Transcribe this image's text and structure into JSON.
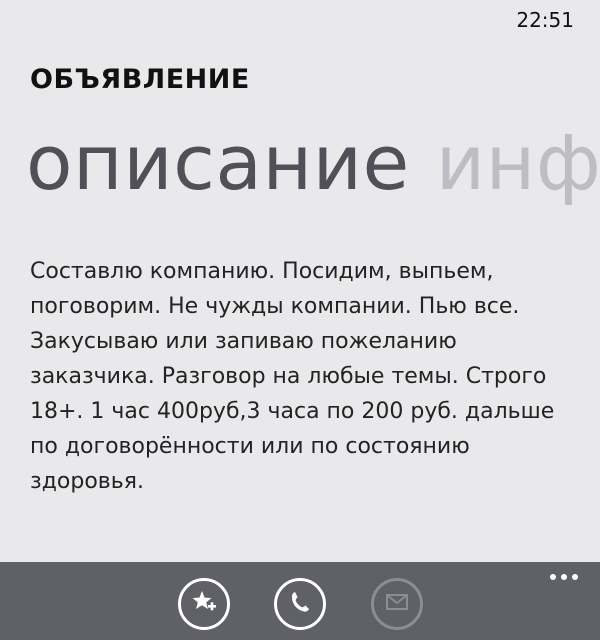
{
  "status_bar": {
    "time": "22:51"
  },
  "header": {
    "title": "ОБЪЯВЛЕНИЕ"
  },
  "pivot": {
    "active": "описание",
    "next": "инф"
  },
  "content": {
    "description": "Составлю компанию. Посидим, выпьем, поговорим. Не чужды компании. Пью все. Закусываю или запиваю пожеланию заказчика. Разговор на любые темы. Строго 18+. 1 час 400руб,3 часа по 200 руб. дальше по договорённости или по состоянию здоровья."
  },
  "app_bar": {
    "buttons": [
      {
        "icon": "add-favorite-icon",
        "enabled": true
      },
      {
        "icon": "phone-icon",
        "enabled": true
      },
      {
        "icon": "mail-icon",
        "enabled": false
      }
    ],
    "more": "more-icon"
  },
  "colors": {
    "background": "#e9e9ec",
    "app_bar": "#5f6068",
    "pivot_active": "#505058",
    "pivot_inactive": "#bdbdc4"
  }
}
